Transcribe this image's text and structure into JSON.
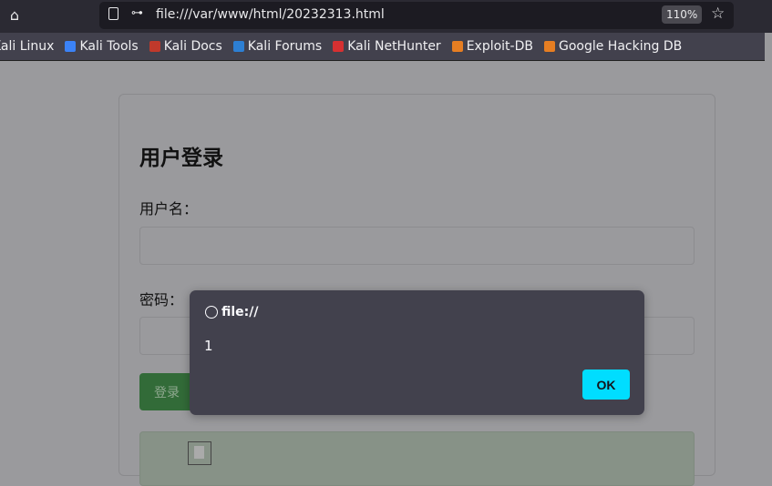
{
  "browser": {
    "url": "file:///var/www/html/20232313.html",
    "zoom": "110%"
  },
  "bookmarks": [
    {
      "label": "Kali Linux",
      "color": "#3b82f6"
    },
    {
      "label": "Kali Tools",
      "color": "#3b82f6"
    },
    {
      "label": "Kali Docs",
      "color": "#c0392b"
    },
    {
      "label": "Kali Forums",
      "color": "#2d7fd3"
    },
    {
      "label": "Kali NetHunter",
      "color": "#d63031"
    },
    {
      "label": "Exploit-DB",
      "color": "#e67e22"
    },
    {
      "label": "Google Hacking DB",
      "color": "#e67e22"
    }
  ],
  "form": {
    "title": "用户登录",
    "username_label": "用户名：",
    "password_label": "密码：",
    "submit": "登录"
  },
  "dialog": {
    "title": "file://",
    "message": "1",
    "ok": "OK"
  }
}
